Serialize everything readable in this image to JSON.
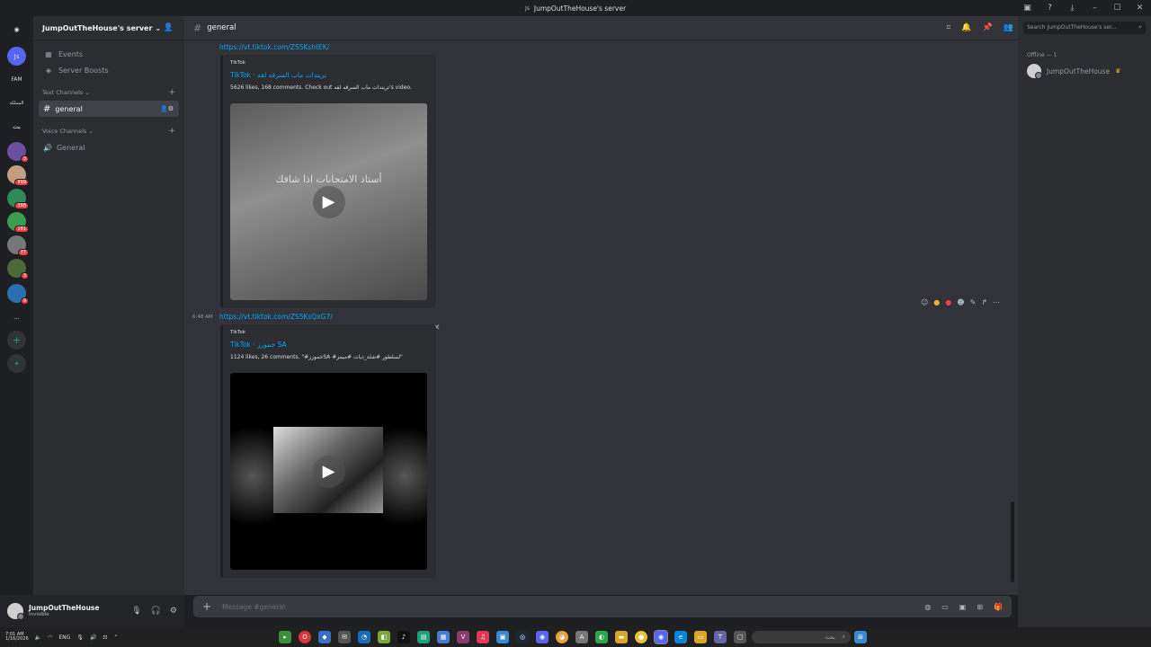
{
  "window": {
    "title": "JumpOutTheHouse's server",
    "title_prefix": "Js",
    "controls": [
      "mirror-icon",
      "help-icon",
      "download-icon",
      "minimize-icon",
      "maximize-icon",
      "close-icon"
    ]
  },
  "guilds": {
    "items": [
      {
        "label": "",
        "icon": "discord-icon"
      },
      {
        "label": "Js"
      },
      {
        "label": "FAM"
      },
      {
        "label": "المملكة"
      },
      {
        "label": "بث"
      },
      {
        "label": "",
        "badge": "3"
      },
      {
        "label": "",
        "badge": "999"
      },
      {
        "label": "",
        "badge": "398"
      },
      {
        "label": "",
        "badge": "181"
      },
      {
        "label": "",
        "badge": "77"
      },
      {
        "label": "",
        "badge": "3"
      },
      {
        "label": "",
        "badge": "9"
      },
      {
        "label": "..."
      },
      {
        "label": "+",
        "icon": "add-server-icon"
      },
      {
        "label": "",
        "icon": "compass-icon"
      }
    ]
  },
  "sidebar": {
    "server_name": "JumpOutTheHouse's server",
    "items": [
      {
        "label": "Events",
        "icon": "calendar-icon"
      },
      {
        "label": "Server Boosts",
        "icon": "boost-icon"
      }
    ],
    "text_category": "Text Channels",
    "text_channels": [
      {
        "label": "general"
      }
    ],
    "voice_category": "Voice Channels",
    "voice_channels": [
      {
        "label": "General"
      }
    ]
  },
  "user": {
    "name": "JumpOutTheHouse",
    "status": "Invisible"
  },
  "chat": {
    "channel": "general",
    "messages": [
      {
        "link": "https://vt.tiktok.com/ZS5KshtEK/",
        "time": "",
        "provider": "TikTok",
        "title": "TikTok · تريندات ماب السرقه لقه",
        "description": "5626 likes, 168 comments. Check out تريندات ماب السرقه لقه's video.",
        "overlay": "أستاذ الامتحانات اذا شافك"
      },
      {
        "link": "https://vt.tiktok.com/ZS5KsQxG7/",
        "time": "6:48 AM",
        "provider": "TikTok",
        "title": "TikTok · خموزز SA",
        "description": "1124 likes, 26 comments. \"#خموززSA #لسلطور #شلة_ذيات #ميمز\"",
        "overlay": ""
      }
    ],
    "composer_placeholder": "Message #general"
  },
  "members": {
    "search_placeholder": "Search JumpOutTheHouse's ser...",
    "offline_label": "Offline — 1",
    "list": [
      {
        "name": "JumpOutTheHouse"
      }
    ]
  },
  "taskbar": {
    "time": "7:01 AM",
    "date": "1/16/2026",
    "lang": "ENG",
    "search_text": "بحث"
  },
  "colors": {
    "accent": "#5865f2",
    "link": "#00a8fc",
    "background": "#313338",
    "sidebar": "#2b2d31"
  }
}
